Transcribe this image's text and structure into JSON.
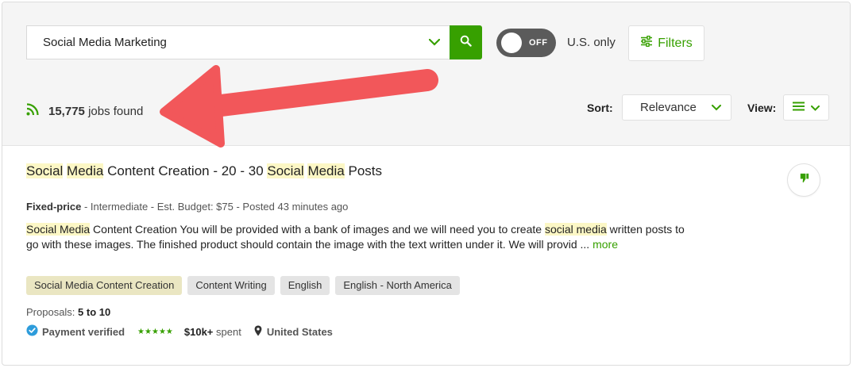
{
  "search": {
    "query": "Social Media Marketing"
  },
  "toggle": {
    "label": "OFF"
  },
  "us_only_label": "U.S. only",
  "filters_label": "Filters",
  "results": {
    "count": "15,775",
    "suffix": "jobs found"
  },
  "sort": {
    "label": "Sort:",
    "selected": "Relevance"
  },
  "view": {
    "label": "View:"
  },
  "job": {
    "title_parts": [
      "Social",
      "Media",
      "Content Creation - 20 - 30",
      "Social",
      "Media",
      "Posts"
    ],
    "type": "Fixed-price",
    "meta": "- Intermediate - Est. Budget: $75 - Posted 43 minutes ago",
    "desc_parts": {
      "hl1": "Social Media",
      "t1": "Content Creation You will be provided with a bank of images and we will need you to create",
      "hl2": "social media",
      "t2": "written posts to go with these images. The finished product should contain the image with the text written under it. We will provid ...",
      "more": "more"
    },
    "tags": [
      "Social Media Content Creation",
      "Content Writing",
      "English",
      "English - North America"
    ],
    "proposals_label": "Proposals:",
    "proposals_value": "5 to 10",
    "payment": "Payment verified",
    "stars": "★★★★★",
    "spent_value": "$10k+",
    "spent_label": "spent",
    "location": "United States"
  },
  "colors": {
    "accent": "#37a000",
    "arrow": "#f2575a",
    "highlight": "#fcf7c5"
  }
}
